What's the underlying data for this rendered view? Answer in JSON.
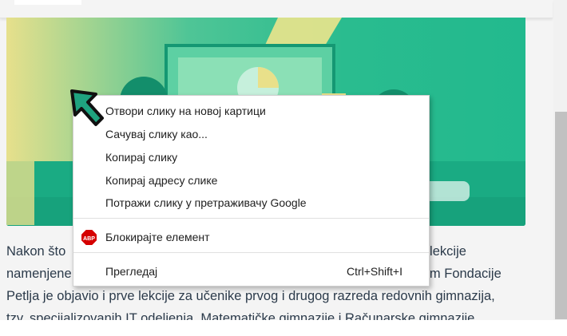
{
  "context_menu": {
    "items": [
      {
        "label": "Отвори слику на новој картици"
      },
      {
        "label": "Сачувај слику као..."
      },
      {
        "label": "Копирај слику"
      },
      {
        "label": "Копирај адресу слике"
      },
      {
        "label": "Потражи слику у претраживачу Google"
      }
    ],
    "block_element": {
      "label": "Блокирајте елемент",
      "icon": "adblock-plus-icon",
      "icon_text": "ABP",
      "icon_color": "#d50000"
    },
    "inspect": {
      "label": "Прегледај",
      "shortcut": "Ctrl+Shift+I"
    }
  },
  "article": {
    "lines": [
      {
        "left": "Nakon što",
        "right": "n lekcije"
      },
      {
        "left": "namenjene",
        "right": "tim Fondacije"
      },
      {
        "full": "Petlja je objavio i prve lekcije za učenike prvog i drugog razreda redovnih gimnazija,"
      },
      {
        "full": "tzv. specijalizovanih IT odeljenja, Matematičke gimnazije i Računarske gimnazije."
      }
    ]
  },
  "colors": {
    "image_green": "#22b98e",
    "image_yellow": "#e9e08a",
    "text": "#2b3a4a",
    "cursor_fill": "#1fa37f"
  }
}
